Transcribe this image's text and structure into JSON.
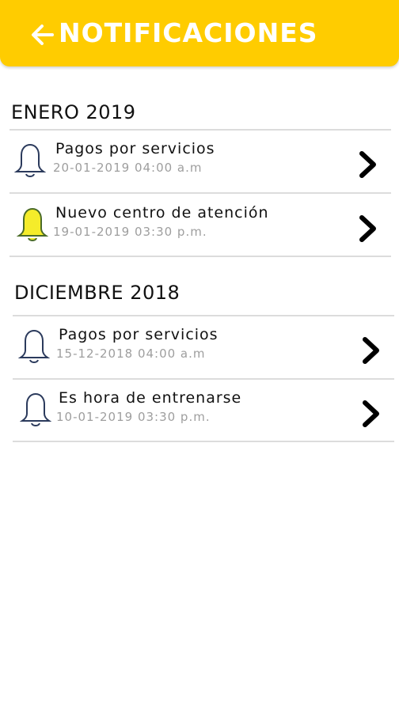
{
  "header": {
    "title": "NOTIFICACIONES",
    "back_icon": "arrow-left-icon",
    "color": "#ffcc00"
  },
  "sections": [
    {
      "title": "ENERO 2019",
      "items": [
        {
          "title": "Pagos por servicios",
          "date": "20-01-2019  04:00 a.m",
          "icon": "bell-outline-icon",
          "unread": false
        },
        {
          "title": "Nuevo centro de atención",
          "date": "19-01-2019  03:30 p.m.",
          "icon": "bell-filled-icon",
          "unread": true
        }
      ]
    },
    {
      "title": "DICIEMBRE 2018",
      "items": [
        {
          "title": "Pagos por servicios",
          "date": "15-12-2018  04:00 a.m",
          "icon": "bell-outline-icon",
          "unread": false
        },
        {
          "title": "Es hora de entrenarse",
          "date": "10-01-2019  03:30 p.m.",
          "icon": "bell-outline-icon",
          "unread": false
        }
      ]
    }
  ],
  "colors": {
    "accent": "#ffcc00",
    "unread_bell": "#f5ec2a",
    "read_bell_stroke": "#2b3a5c"
  }
}
